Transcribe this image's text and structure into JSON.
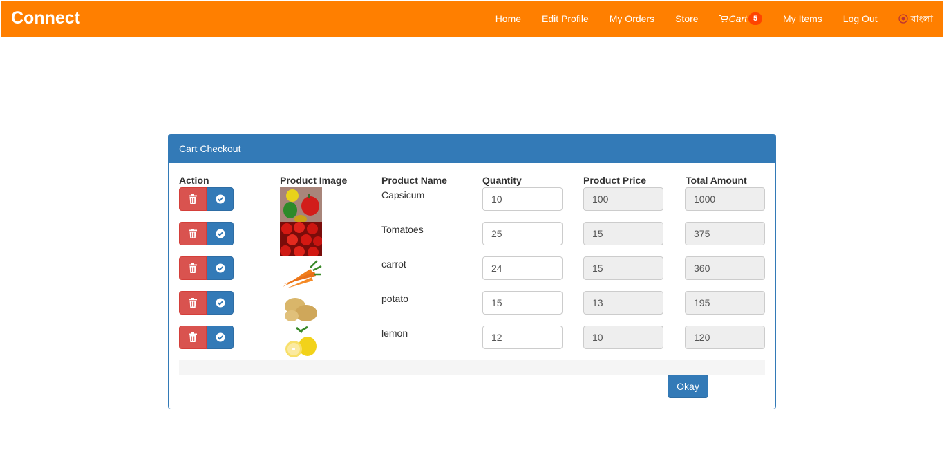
{
  "navbar": {
    "brand": "Connect",
    "links": [
      "Home",
      "Edit Profile",
      "My Orders",
      "Store"
    ],
    "cart_label": "Cart",
    "cart_count": "5",
    "links_after": [
      "My Items",
      "Log Out"
    ],
    "language": "বাংলা",
    "bg_color": "#ff7f00"
  },
  "panel": {
    "title": "Cart Checkout",
    "columns": [
      "Action",
      "Product Image",
      "Product Name",
      "Quantity",
      "Product Price",
      "Total Amount"
    ],
    "rows": [
      {
        "name": "Capsicum",
        "quantity": "10",
        "price": "100",
        "total": "1000",
        "image": "capsicum-image"
      },
      {
        "name": "Tomatoes",
        "quantity": "25",
        "price": "15",
        "total": "375",
        "image": "tomatoes-image"
      },
      {
        "name": "carrot",
        "quantity": "24",
        "price": "15",
        "total": "360",
        "image": "carrot-image"
      },
      {
        "name": "potato",
        "quantity": "15",
        "price": "13",
        "total": "195",
        "image": "potato-image"
      },
      {
        "name": "lemon",
        "quantity": "12",
        "price": "10",
        "total": "120",
        "image": "lemon-image"
      }
    ],
    "okay_label": "Okay"
  }
}
